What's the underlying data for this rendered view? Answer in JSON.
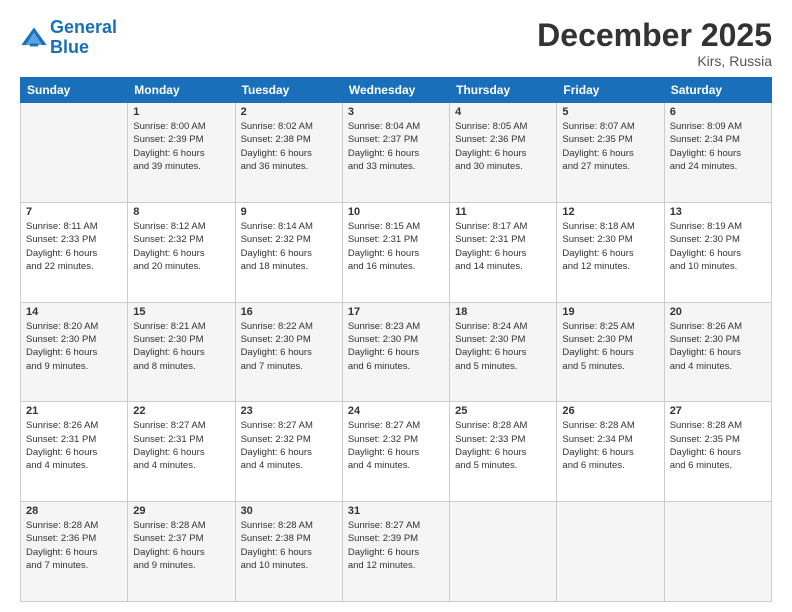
{
  "header": {
    "logo_line1": "General",
    "logo_line2": "Blue",
    "month": "December 2025",
    "location": "Kirs, Russia"
  },
  "days_of_week": [
    "Sunday",
    "Monday",
    "Tuesday",
    "Wednesday",
    "Thursday",
    "Friday",
    "Saturday"
  ],
  "weeks": [
    [
      {
        "day": "",
        "info": ""
      },
      {
        "day": "1",
        "info": "Sunrise: 8:00 AM\nSunset: 2:39 PM\nDaylight: 6 hours\nand 39 minutes."
      },
      {
        "day": "2",
        "info": "Sunrise: 8:02 AM\nSunset: 2:38 PM\nDaylight: 6 hours\nand 36 minutes."
      },
      {
        "day": "3",
        "info": "Sunrise: 8:04 AM\nSunset: 2:37 PM\nDaylight: 6 hours\nand 33 minutes."
      },
      {
        "day": "4",
        "info": "Sunrise: 8:05 AM\nSunset: 2:36 PM\nDaylight: 6 hours\nand 30 minutes."
      },
      {
        "day": "5",
        "info": "Sunrise: 8:07 AM\nSunset: 2:35 PM\nDaylight: 6 hours\nand 27 minutes."
      },
      {
        "day": "6",
        "info": "Sunrise: 8:09 AM\nSunset: 2:34 PM\nDaylight: 6 hours\nand 24 minutes."
      }
    ],
    [
      {
        "day": "7",
        "info": "Sunrise: 8:11 AM\nSunset: 2:33 PM\nDaylight: 6 hours\nand 22 minutes."
      },
      {
        "day": "8",
        "info": "Sunrise: 8:12 AM\nSunset: 2:32 PM\nDaylight: 6 hours\nand 20 minutes."
      },
      {
        "day": "9",
        "info": "Sunrise: 8:14 AM\nSunset: 2:32 PM\nDaylight: 6 hours\nand 18 minutes."
      },
      {
        "day": "10",
        "info": "Sunrise: 8:15 AM\nSunset: 2:31 PM\nDaylight: 6 hours\nand 16 minutes."
      },
      {
        "day": "11",
        "info": "Sunrise: 8:17 AM\nSunset: 2:31 PM\nDaylight: 6 hours\nand 14 minutes."
      },
      {
        "day": "12",
        "info": "Sunrise: 8:18 AM\nSunset: 2:30 PM\nDaylight: 6 hours\nand 12 minutes."
      },
      {
        "day": "13",
        "info": "Sunrise: 8:19 AM\nSunset: 2:30 PM\nDaylight: 6 hours\nand 10 minutes."
      }
    ],
    [
      {
        "day": "14",
        "info": "Sunrise: 8:20 AM\nSunset: 2:30 PM\nDaylight: 6 hours\nand 9 minutes."
      },
      {
        "day": "15",
        "info": "Sunrise: 8:21 AM\nSunset: 2:30 PM\nDaylight: 6 hours\nand 8 minutes."
      },
      {
        "day": "16",
        "info": "Sunrise: 8:22 AM\nSunset: 2:30 PM\nDaylight: 6 hours\nand 7 minutes."
      },
      {
        "day": "17",
        "info": "Sunrise: 8:23 AM\nSunset: 2:30 PM\nDaylight: 6 hours\nand 6 minutes."
      },
      {
        "day": "18",
        "info": "Sunrise: 8:24 AM\nSunset: 2:30 PM\nDaylight: 6 hours\nand 5 minutes."
      },
      {
        "day": "19",
        "info": "Sunrise: 8:25 AM\nSunset: 2:30 PM\nDaylight: 6 hours\nand 5 minutes."
      },
      {
        "day": "20",
        "info": "Sunrise: 8:26 AM\nSunset: 2:30 PM\nDaylight: 6 hours\nand 4 minutes."
      }
    ],
    [
      {
        "day": "21",
        "info": "Sunrise: 8:26 AM\nSunset: 2:31 PM\nDaylight: 6 hours\nand 4 minutes."
      },
      {
        "day": "22",
        "info": "Sunrise: 8:27 AM\nSunset: 2:31 PM\nDaylight: 6 hours\nand 4 minutes."
      },
      {
        "day": "23",
        "info": "Sunrise: 8:27 AM\nSunset: 2:32 PM\nDaylight: 6 hours\nand 4 minutes."
      },
      {
        "day": "24",
        "info": "Sunrise: 8:27 AM\nSunset: 2:32 PM\nDaylight: 6 hours\nand 4 minutes."
      },
      {
        "day": "25",
        "info": "Sunrise: 8:28 AM\nSunset: 2:33 PM\nDaylight: 6 hours\nand 5 minutes."
      },
      {
        "day": "26",
        "info": "Sunrise: 8:28 AM\nSunset: 2:34 PM\nDaylight: 6 hours\nand 6 minutes."
      },
      {
        "day": "27",
        "info": "Sunrise: 8:28 AM\nSunset: 2:35 PM\nDaylight: 6 hours\nand 6 minutes."
      }
    ],
    [
      {
        "day": "28",
        "info": "Sunrise: 8:28 AM\nSunset: 2:36 PM\nDaylight: 6 hours\nand 7 minutes."
      },
      {
        "day": "29",
        "info": "Sunrise: 8:28 AM\nSunset: 2:37 PM\nDaylight: 6 hours\nand 9 minutes."
      },
      {
        "day": "30",
        "info": "Sunrise: 8:28 AM\nSunset: 2:38 PM\nDaylight: 6 hours\nand 10 minutes."
      },
      {
        "day": "31",
        "info": "Sunrise: 8:27 AM\nSunset: 2:39 PM\nDaylight: 6 hours\nand 12 minutes."
      },
      {
        "day": "",
        "info": ""
      },
      {
        "day": "",
        "info": ""
      },
      {
        "day": "",
        "info": ""
      }
    ]
  ]
}
